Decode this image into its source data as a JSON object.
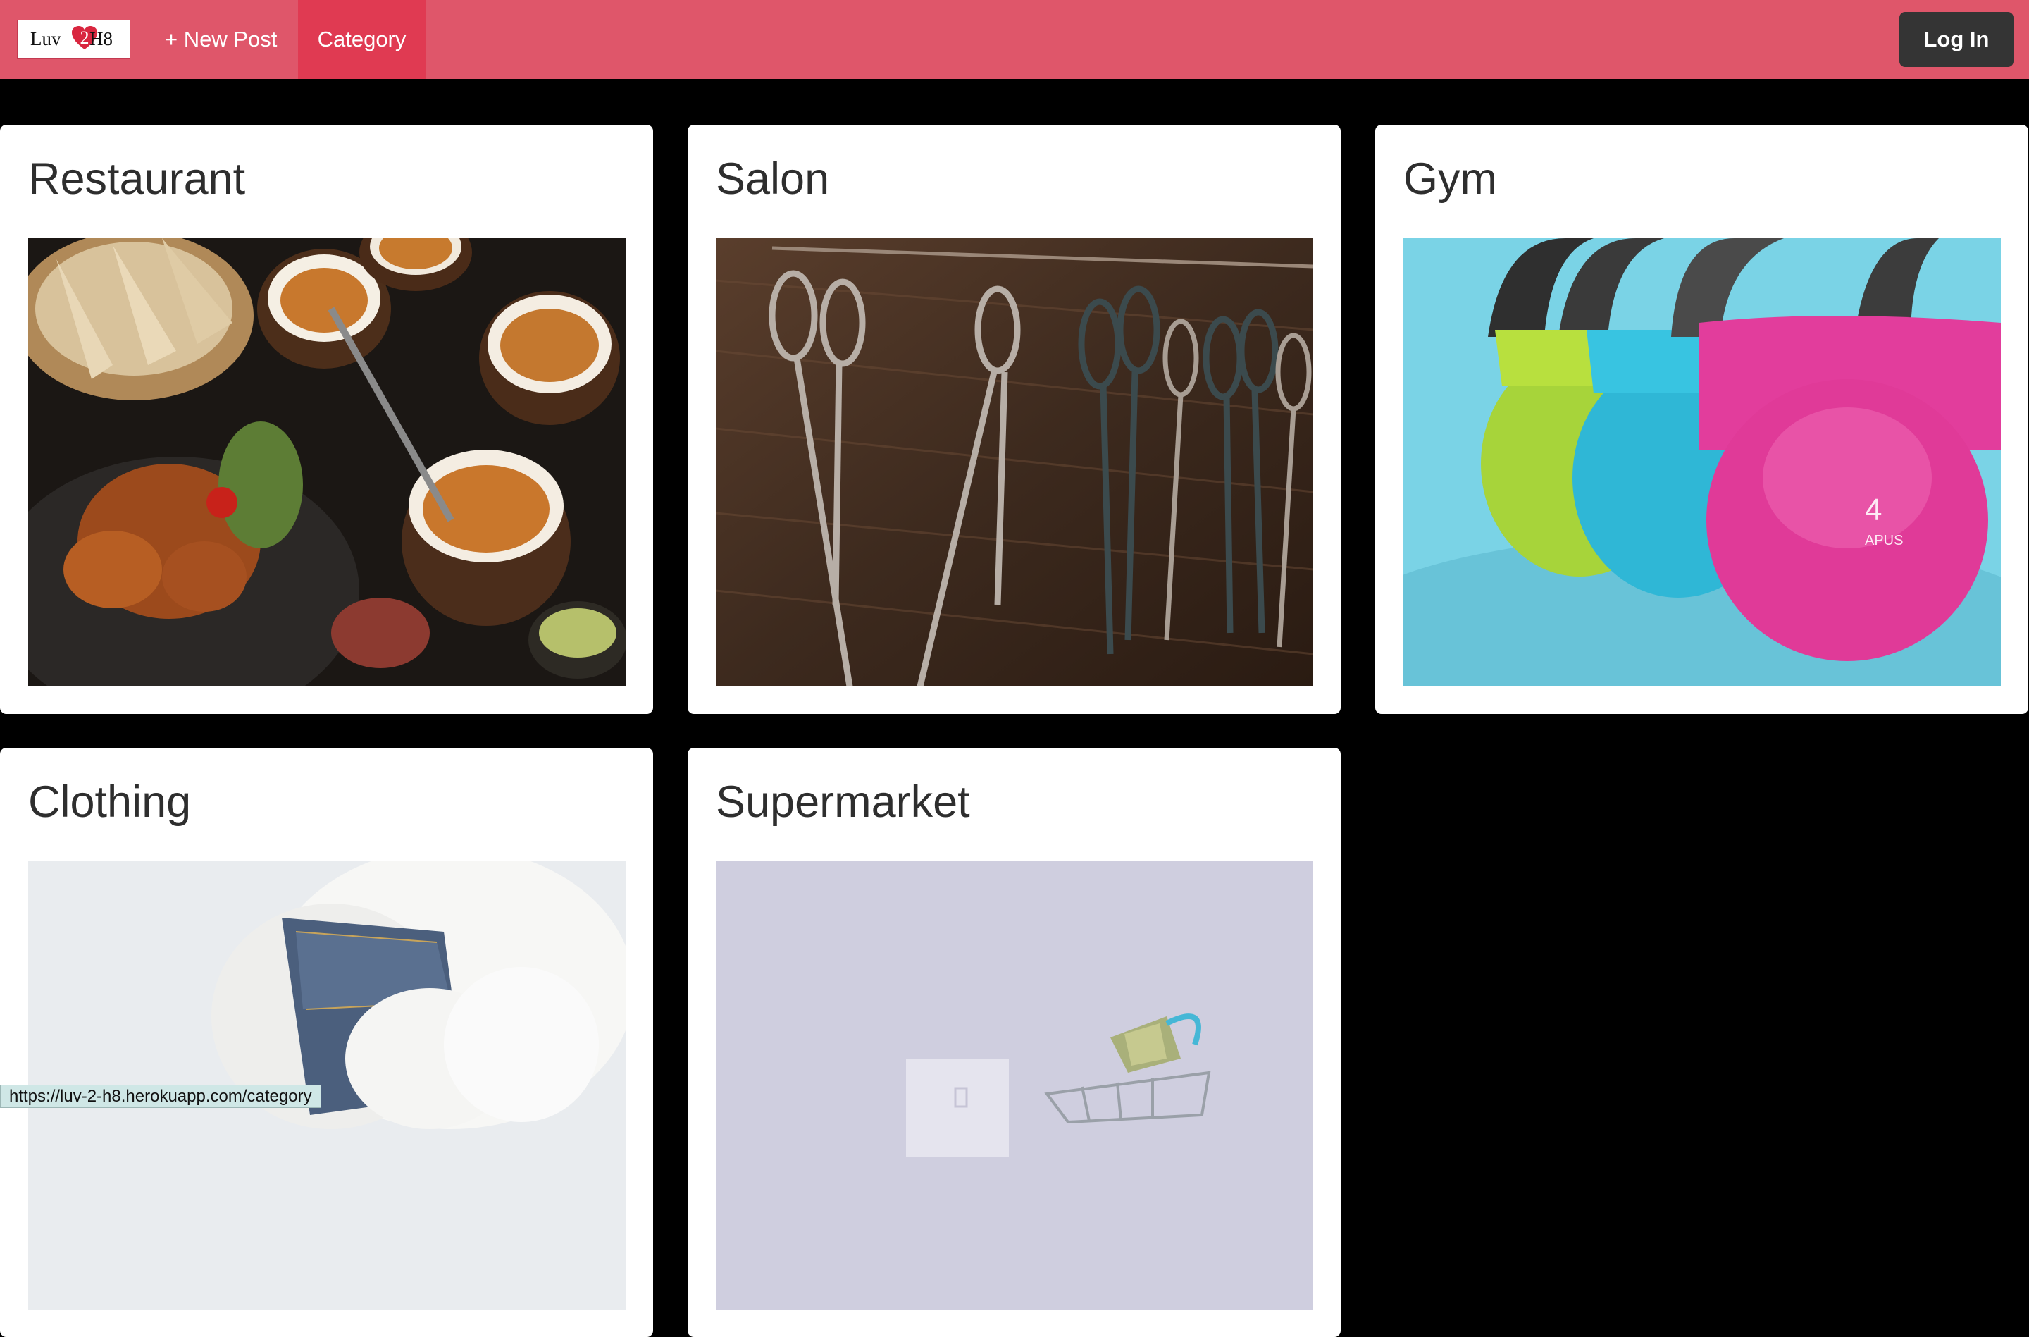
{
  "navbar": {
    "logo": {
      "left": "Luv",
      "heart_number": "2",
      "right": "H8"
    },
    "new_post_label": "+ New Post",
    "category_label": "Category",
    "login_label": "Log In"
  },
  "categories": [
    {
      "title": "Restaurant",
      "image": "restaurant-photo"
    },
    {
      "title": "Salon",
      "image": "salon-scissors-photo"
    },
    {
      "title": "Gym",
      "image": "gym-kettlebells-photo"
    },
    {
      "title": "Clothing",
      "image": "clothing-photo"
    },
    {
      "title": "Supermarket",
      "image": "supermarket-cart-photo"
    }
  ],
  "status_bar": {
    "url": "https://luv-2-h8.herokuapp.com/category"
  },
  "colors": {
    "navbar": "#df566a",
    "active_nav": "#e03a52",
    "login_button": "#343434",
    "page_background": "#000000"
  }
}
